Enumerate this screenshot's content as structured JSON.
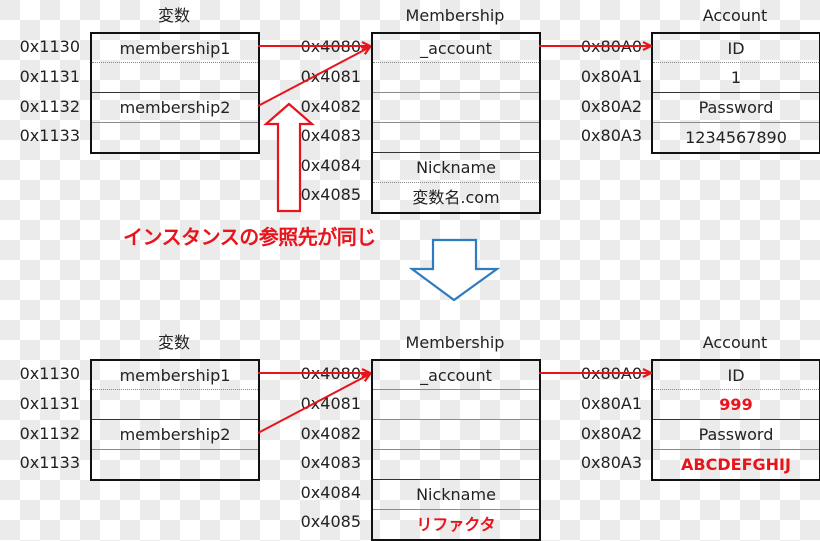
{
  "colors": {
    "arrow_red": "#e8141c",
    "arrow_blue": "#2f7bbf",
    "text": "#222222",
    "highlight_red": "#e8141c"
  },
  "caption": "インスタンスの参照先が同じ",
  "sections": [
    {
      "name": "before",
      "variables": {
        "title": "変数",
        "addresses": [
          "0x1130",
          "0x1131",
          "0x1132",
          "0x1133"
        ],
        "cells": [
          "membership1",
          "",
          "membership2",
          ""
        ]
      },
      "membership": {
        "title": "Membership",
        "addresses": [
          "0x4080",
          "0x4081",
          "0x4082",
          "0x4083",
          "0x4084",
          "0x4085"
        ],
        "cells": [
          "_account",
          "",
          "",
          "",
          "Nickname",
          "変数名.com"
        ]
      },
      "account": {
        "title": "Account",
        "addresses": [
          "0x80A0",
          "0x80A1",
          "0x80A2",
          "0x80A3"
        ],
        "cells": [
          "ID",
          "1",
          "Password",
          "1234567890"
        ]
      }
    },
    {
      "name": "after",
      "variables": {
        "title": "変数",
        "addresses": [
          "0x1130",
          "0x1131",
          "0x1132",
          "0x1133"
        ],
        "cells": [
          "membership1",
          "",
          "membership2",
          ""
        ]
      },
      "membership": {
        "title": "Membership",
        "addresses": [
          "0x4080",
          "0x4081",
          "0x4082",
          "0x4083",
          "0x4084",
          "0x4085"
        ],
        "cells": [
          "_account",
          "",
          "",
          "",
          "Nickname",
          "リファクタ"
        ]
      },
      "account": {
        "title": "Account",
        "addresses": [
          "0x80A0",
          "0x80A1",
          "0x80A2",
          "0x80A3"
        ],
        "cells": [
          "ID",
          "999",
          "Password",
          "ABCDEFGHIJ"
        ]
      }
    }
  ]
}
